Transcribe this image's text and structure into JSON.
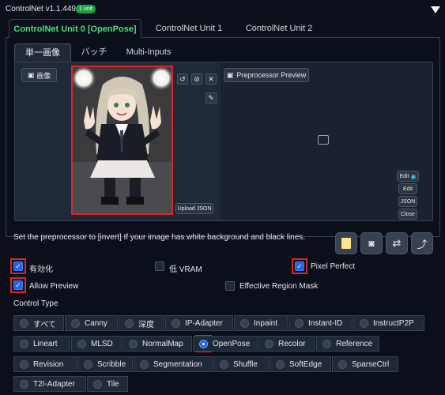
{
  "header": {
    "title": "ControlNet v1.1.449",
    "badge": "1 unit"
  },
  "units": [
    "ControlNet Unit 0 [OpenPose]",
    "ControlNet Unit 1",
    "ControlNet Unit 2"
  ],
  "subtabs": [
    "単一画像",
    "バッチ",
    "Multi-Inputs"
  ],
  "image_label": "画像",
  "preprocessor_preview": "Preprocessor Preview",
  "upload_json": "Upload JSON",
  "edit_buttons": [
    "Edit",
    "Edit",
    "JSON",
    "Close"
  ],
  "note": "Set the preprocessor to [invert] If your image has white background and black lines.",
  "options": {
    "enable": "有効化",
    "low_vram": "低 VRAM",
    "pixel_perfect": "Pixel Perfect",
    "allow_preview": "Allow Preview",
    "effective_region_mask": "Effective Region Mask"
  },
  "control_type": {
    "label": "Control Type",
    "row1": [
      "すべて",
      "Canny",
      "深度",
      "IP-Adapter",
      "Inpaint",
      "Instant-ID",
      "InstructP2P"
    ],
    "row2": [
      "Lineart",
      "MLSD",
      "NormalMap",
      "OpenPose",
      "Recolor",
      "Reference"
    ],
    "row3": [
      "Revision",
      "Scribble",
      "Segmentation",
      "Shuffle",
      "SoftEdge",
      "SparseCtrl"
    ],
    "row4": [
      "T2I-Adapter",
      "Tile"
    ],
    "selected": "OpenPose"
  },
  "colors": {
    "accent": "#4ade80",
    "highlight": "#dc2626",
    "checked": "#2563eb"
  }
}
